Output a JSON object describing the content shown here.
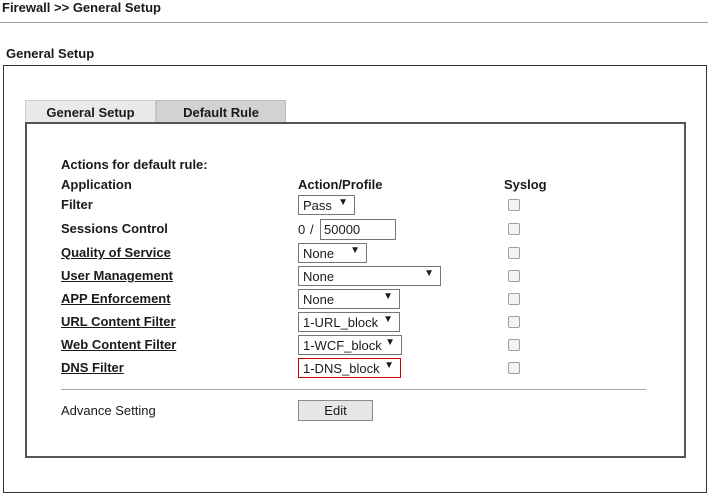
{
  "header": {
    "breadcrumb": "Firewall >> General Setup",
    "section_title": "General Setup"
  },
  "tabs": [
    {
      "label": "General Setup",
      "active": false
    },
    {
      "label": "Default Rule",
      "active": true
    }
  ],
  "form": {
    "heading": "Actions for default rule:",
    "columns": {
      "application": "Application",
      "action": "Action/Profile",
      "syslog": "Syslog"
    },
    "rows": {
      "filter": {
        "label": "Filter",
        "value": "Pass",
        "syslog": false
      },
      "sessions": {
        "label": "Sessions Control",
        "current": "0",
        "sep": "/",
        "value": "50000",
        "syslog": false
      },
      "qos": {
        "label": "Quality of Service",
        "value": "None",
        "syslog": false
      },
      "user_mgmt": {
        "label": "User Management",
        "value": "None",
        "syslog": false
      },
      "app_enf": {
        "label": "APP Enforcement",
        "value": "None",
        "syslog": false
      },
      "url_filter": {
        "label": "URL Content Filter",
        "value": "1-URL_block",
        "syslog": false
      },
      "web_filter": {
        "label": "Web Content Filter",
        "value": "1-WCF_block",
        "syslog": false
      },
      "dns_filter": {
        "label": "DNS Filter",
        "value": "1-DNS_block",
        "syslog": false
      }
    },
    "advance": {
      "label": "Advance Setting",
      "button": "Edit"
    }
  },
  "icons": {
    "dropdown_arrow": "▼"
  },
  "colors": {
    "dns_select_border": "#cc0000"
  }
}
